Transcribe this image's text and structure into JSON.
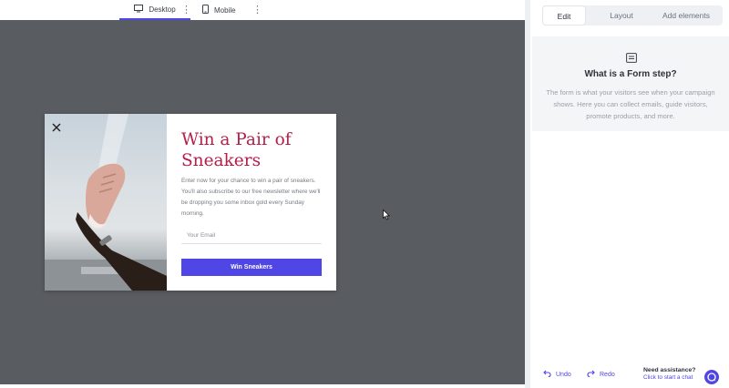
{
  "device_bar": {
    "desktop_label": "Desktop",
    "mobile_label": "Mobile",
    "more_glyph": "⋮"
  },
  "popup": {
    "title": "Win a Pair of Sneakers",
    "description": "Enter now for your chance to win a pair of sneakers. You'll also subscribe to our free newsletter where we'll be dropping you some inbox gold every Sunday morning.",
    "email_placeholder": "Your Email",
    "email_value": "",
    "cta_label": "Win Sneakers",
    "title_color": "#b51e4b",
    "cta_color": "#4f46e5"
  },
  "panel": {
    "tabs": [
      {
        "label": "Edit",
        "active": true
      },
      {
        "label": "Layout",
        "active": false
      },
      {
        "label": "Add elements",
        "active": false
      }
    ],
    "info": {
      "icon": "form-step-icon",
      "title": "What is a Form step?",
      "text": "The form is what your visitors see when your campaign shows. Here you can collect emails, guide visitors, promote products, and more."
    },
    "footer": {
      "undo_label": "Undo",
      "redo_label": "Redo",
      "assist_title": "Need assistance?",
      "assist_link": "Click to start a chat"
    }
  },
  "colors": {
    "accent": "#4f46e5",
    "canvas_bg": "#595c61"
  }
}
